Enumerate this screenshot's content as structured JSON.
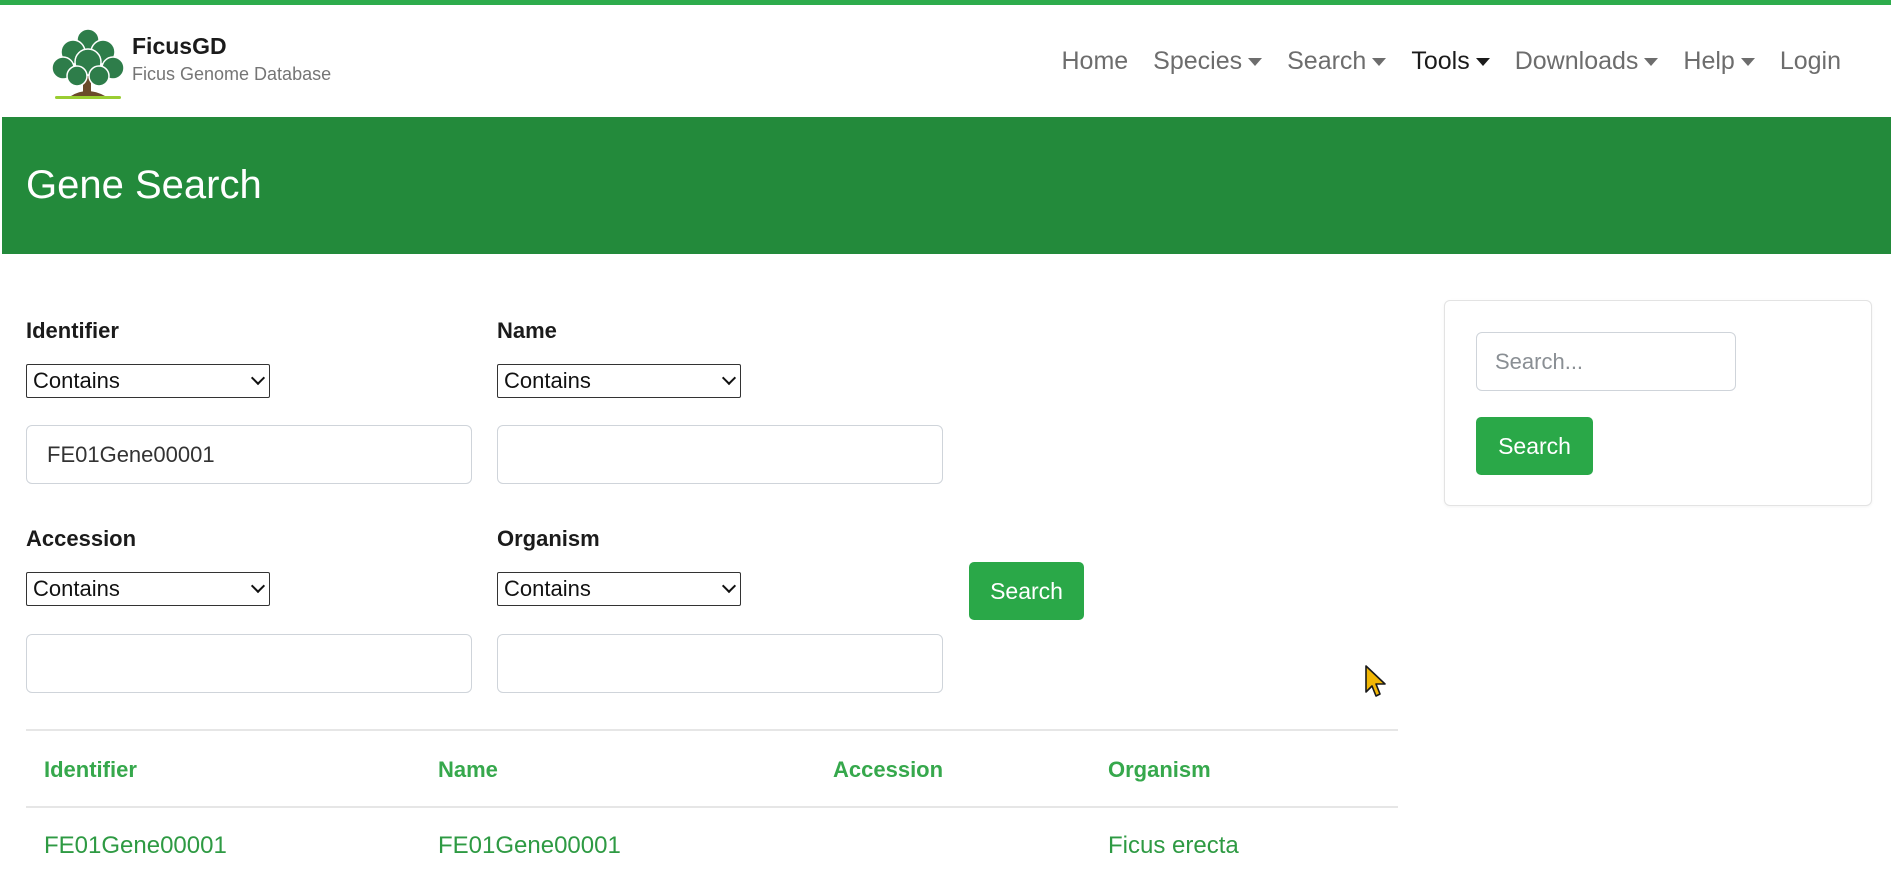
{
  "brand": {
    "name": "FicusGD",
    "subtitle": "Ficus Genome Database",
    "logo_icon": "ficus-tree-icon"
  },
  "nav": {
    "items": [
      {
        "label": "Home",
        "dropdown": false,
        "active": false
      },
      {
        "label": "Species",
        "dropdown": true,
        "active": false
      },
      {
        "label": "Search",
        "dropdown": true,
        "active": false
      },
      {
        "label": "Tools",
        "dropdown": true,
        "active": true
      },
      {
        "label": "Downloads",
        "dropdown": true,
        "active": false
      },
      {
        "label": "Help",
        "dropdown": true,
        "active": false
      },
      {
        "label": "Login",
        "dropdown": false,
        "active": false
      }
    ]
  },
  "banner": {
    "title": "Gene Search"
  },
  "form": {
    "identifier": {
      "label": "Identifier",
      "operator": "Contains",
      "value": "FE01Gene00001"
    },
    "name": {
      "label": "Name",
      "operator": "Contains",
      "value": ""
    },
    "accession": {
      "label": "Accession",
      "operator": "Contains",
      "value": ""
    },
    "organism": {
      "label": "Organism",
      "operator": "Contains",
      "value": ""
    },
    "submit_label": "Search"
  },
  "results": {
    "columns": [
      "Identifier",
      "Name",
      "Accession",
      "Organism"
    ],
    "rows": [
      {
        "identifier": "FE01Gene00001",
        "name": "FE01Gene00001",
        "accession": "",
        "organism": "Ficus erecta"
      }
    ]
  },
  "sidebar": {
    "search_placeholder": "Search...",
    "search_button": "Search"
  },
  "colors": {
    "brand_green": "#238a3b",
    "button_green": "#2aa848",
    "link_green": "#36a84c",
    "top_stripe": "#2eac4c"
  }
}
